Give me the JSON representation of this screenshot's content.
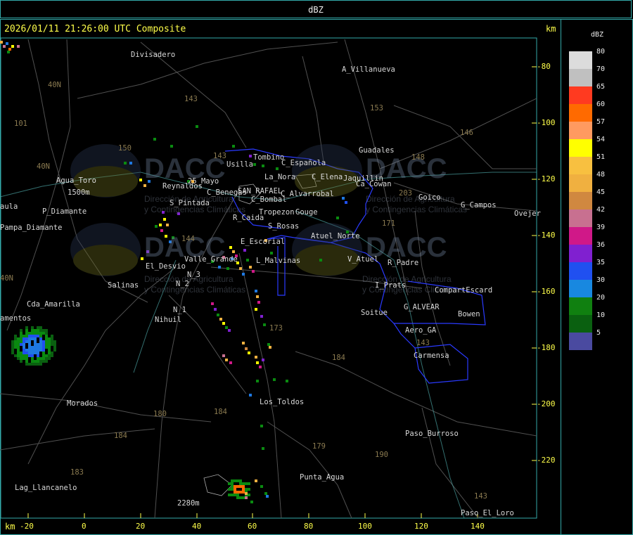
{
  "header": {
    "title": "dBZ"
  },
  "map": {
    "timestamp": "2026/01/11 21:26:00 UTC Composite",
    "km_label_top": "km",
    "km_label_bottom": "km",
    "x_ticks": [
      "-20",
      "0",
      "20",
      "40",
      "60",
      "80",
      "100",
      "120",
      "140"
    ],
    "y_ticks": [
      "-80",
      "-100",
      "-120",
      "-140",
      "-160",
      "-180",
      "-200",
      "-220"
    ],
    "places": [
      "Divisadero",
      "A_Villanueva",
      "Guadales",
      "Tombino",
      "C_Española",
      "Usilla",
      "La_Nora",
      "C_Elena",
      "Jaquillin",
      "Ca_Cowan",
      "Goico",
      "G_Campos",
      "Ovejer",
      "Agua_Toro",
      "Reynaldos",
      "25_Mayo",
      "C_Benegas",
      "SAN_RAFAEL",
      "C_Alvarrobal",
      "C_Bombal",
      "aula",
      "P_Diamante",
      "S_Pintada",
      "R_Caida",
      "Tropezon",
      "Gouge",
      "Pampa_Diamante",
      "S_Rosas",
      "Atuel_Norte",
      "E_Escorial",
      "Valle_Grande",
      "L_Malvinas",
      "V_Atuel",
      "R_Padre",
      "El_Desvio",
      "N_3",
      "N_2",
      "Salinas",
      "I_Prats",
      "CompartEscard",
      "Cda_Amarilla",
      "N_1",
      "Nihuil",
      "Soitue",
      "G_ALVEAR",
      "Bowen",
      "amentos",
      "Aero_GA",
      "Carmensa",
      "Morados",
      "Los_Toldos",
      "Paso_Burroso",
      "Punta_Agua",
      "Lag_Llancanelo",
      "2280m",
      "Paso_El_Loro",
      "1500m"
    ],
    "roads": [
      "40N",
      "101",
      "143",
      "153",
      "146",
      "148",
      "203",
      "150",
      "40N",
      "143",
      "144",
      "171",
      "173",
      "184",
      "180",
      "184",
      "179",
      "190",
      "184",
      "183",
      "143",
      "40N",
      "143"
    ],
    "watermark": {
      "logo_text": "DACC",
      "subtitle_1": "Dirección de Agricultura",
      "subtitle_2": "y Contingencias Climáticas"
    }
  },
  "legend": {
    "title": "dBZ",
    "colors": [
      {
        "label": "80",
        "color": "#dcdcdc"
      },
      {
        "label": "70",
        "color": "#c0c0c0"
      },
      {
        "label": "65",
        "color": "#ff3a20"
      },
      {
        "label": "60",
        "color": "#ff6a00"
      },
      {
        "label": "57",
        "color": "#ff9a60"
      },
      {
        "label": "54",
        "color": "#ffff00"
      },
      {
        "label": "51",
        "color": "#f8c040"
      },
      {
        "label": "48",
        "color": "#f0b040"
      },
      {
        "label": "45",
        "color": "#d08840"
      },
      {
        "label": "42",
        "color": "#c87090"
      },
      {
        "label": "39",
        "color": "#d01888"
      },
      {
        "label": "36",
        "color": "#8020d0"
      },
      {
        "label": "35",
        "color": "#2050f0"
      },
      {
        "label": "30",
        "color": "#1888e0"
      },
      {
        "label": "20",
        "color": "#108010"
      },
      {
        "label": "10",
        "color": "#0a6010"
      },
      {
        "label": "5",
        "color": "#4a4aa0"
      }
    ]
  }
}
